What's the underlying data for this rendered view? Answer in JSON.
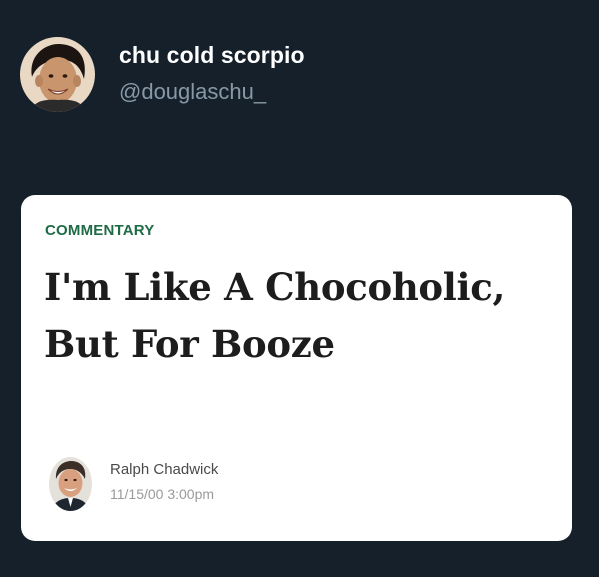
{
  "tweet": {
    "display_name": "chu cold scorpio",
    "handle": "@douglaschu_",
    "avatar_icon": "user-avatar-photo"
  },
  "article_card": {
    "section": "COMMENTARY",
    "headline": "I'm Like A Chocoholic, But For Booze",
    "author_name": "Ralph Chadwick",
    "date": "11/15/00 3:00pm",
    "author_icon": "author-photo",
    "colors": {
      "section": "#1f6b45",
      "background": "#15202b",
      "card": "#ffffff"
    }
  }
}
